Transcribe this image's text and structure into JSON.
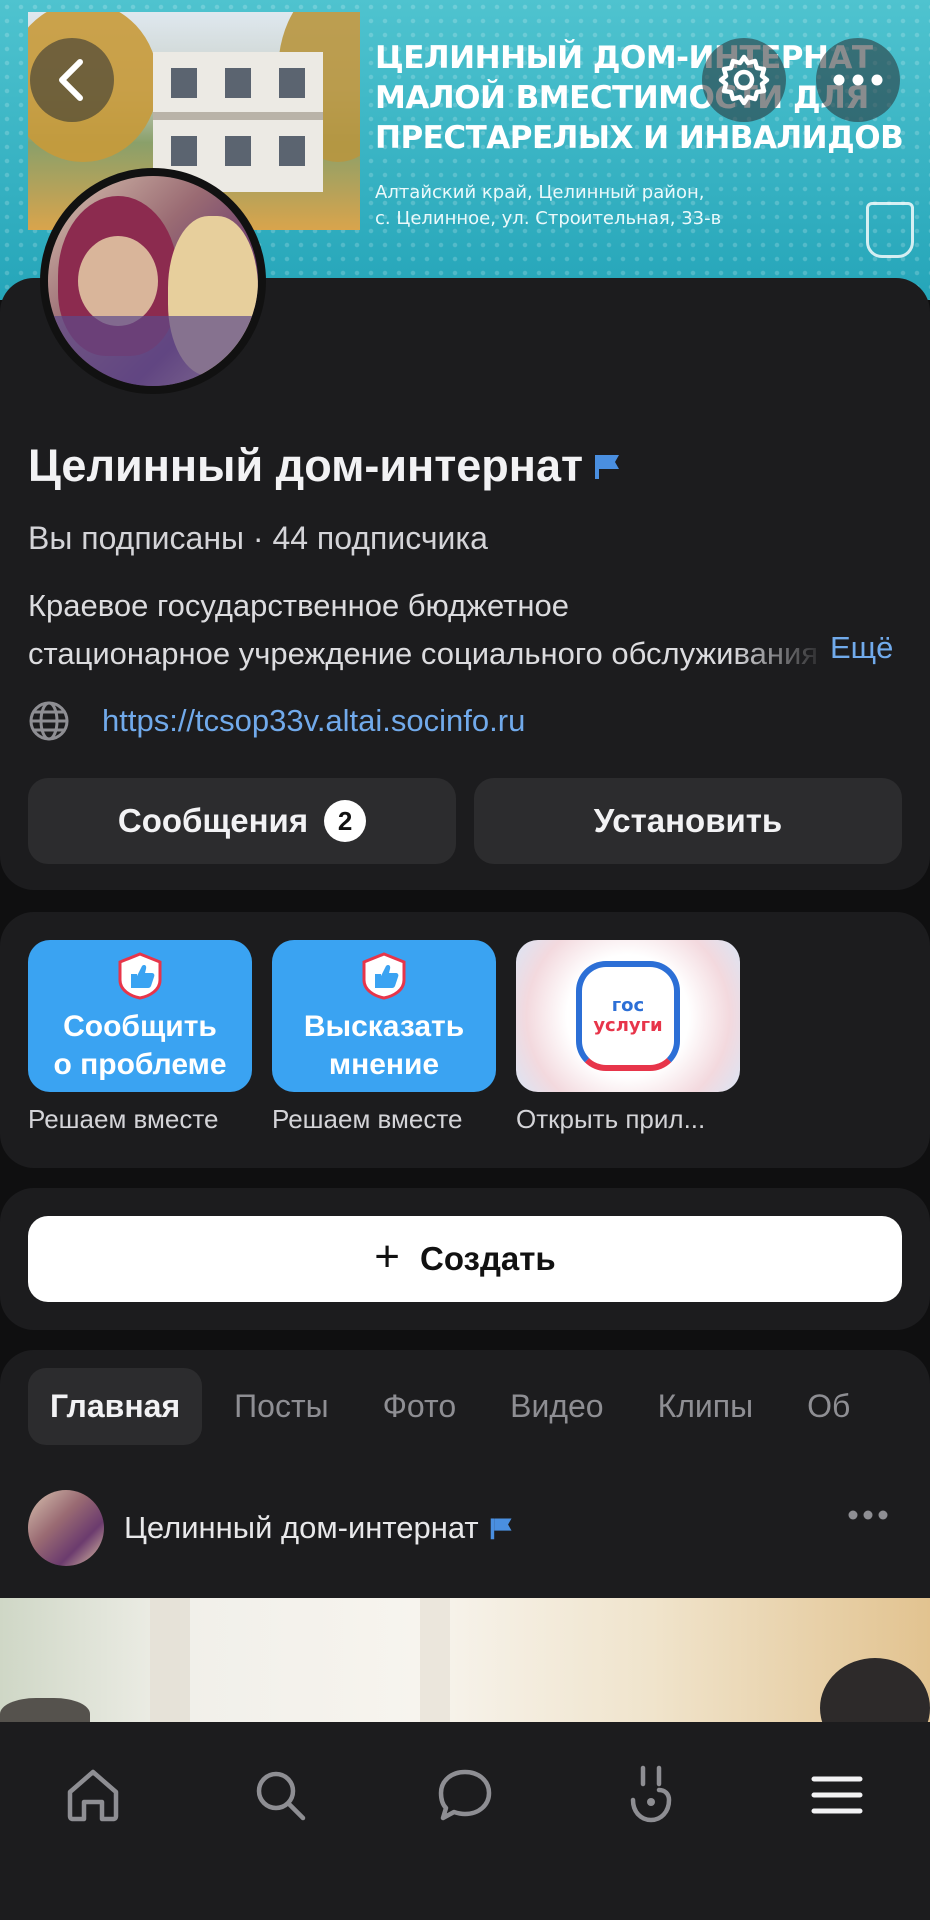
{
  "cover": {
    "title": "Целинный дом-интернат малой вместимости для престарелых и инвалидов",
    "address_line1": "Алтайский край, Целинный район,",
    "address_line2": "с. Целинное, ул. Строительная, 33-в"
  },
  "header": {
    "back_icon": "chevron-left-icon",
    "settings_icon": "gear-icon",
    "more_icon": "more-horizontal-icon"
  },
  "profile": {
    "name": "Целинный дом-интернат",
    "verified_icon": "flag-icon",
    "subscribers": "Вы подписаны · 44 подписчика",
    "description_line1": "Краевое государственное бюджетное",
    "description_line2": "стационарное учреждение социального обслуживания",
    "more_label": "Ещё",
    "link": "https://tcsop33v.altai.socinfo.ru",
    "messages_label": "Сообщения",
    "messages_count": "2",
    "install_label": "Установить"
  },
  "services": [
    {
      "tile_line1": "Сообщить",
      "tile_line2": "о проблеме",
      "caption": "Решаем вместе"
    },
    {
      "tile_line1": "Высказать",
      "tile_line2": "мнение",
      "caption": "Решаем вместе"
    },
    {
      "logo_line1": "гос",
      "logo_line2": "услуги",
      "caption": "Открыть прил..."
    }
  ],
  "create": {
    "label": "Создать"
  },
  "tabs": [
    "Главная",
    "Посты",
    "Фото",
    "Видео",
    "Клипы",
    "Об"
  ],
  "post": {
    "author": "Целинный дом-интернат"
  },
  "colors": {
    "accent": "#71aaeb",
    "card": "#1c1c1e",
    "button": "#2c2c2e",
    "service_blue": "#3aa3f2"
  },
  "bottom_nav": [
    "home-icon",
    "search-icon",
    "messages-icon",
    "clips-icon",
    "menu-icon"
  ]
}
